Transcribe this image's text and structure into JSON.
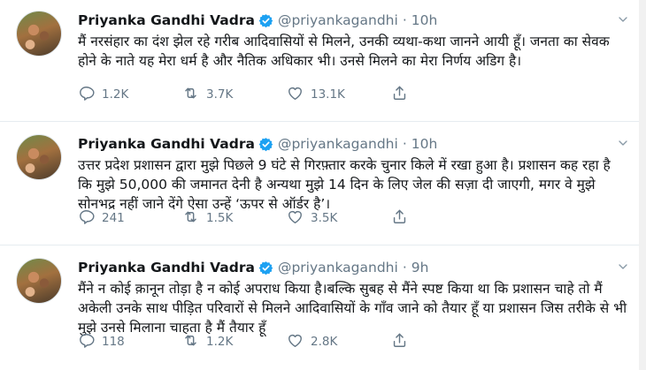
{
  "tweets": [
    {
      "name": "Priyanka Gandhi Vadra",
      "handle": "@priyankagandhi",
      "separator": "·",
      "time": "10h",
      "text": "मैं नरसंहार का दंश झेल रहे गरीब आदिवासियों से मिलने, उनकी व्यथा-कथा जानने आयी हूँ। जनता का सेवक होने के नाते यह मेरा धर्म है और नैतिक अधिकार भी। उनसे मिलने का मेरा निर्णय अडिग है।",
      "replies": "1.2K",
      "retweets": "3.7K",
      "likes": "13.1K"
    },
    {
      "name": "Priyanka Gandhi Vadra",
      "handle": "@priyankagandhi",
      "separator": "·",
      "time": "10h",
      "text": "उत्तर प्रदेश प्रशासन द्वारा मुझे पिछले 9 घंटे से गिरफ़्तार करके चुनार किले में रखा हुआ है। प्रशासन कह रहा है कि मुझे 50,000 की जमानत देनी है अन्यथा मुझे 14 दिन के लिए जेल की सज़ा दी जाएगी, मगर वे मुझे सोनभद्र नहीं जाने देंगे ऐसा उन्हें ‘ऊपर से ऑर्डर है’।",
      "replies": "241",
      "retweets": "1.5K",
      "likes": "3.5K"
    },
    {
      "name": "Priyanka Gandhi Vadra",
      "handle": "@priyankagandhi",
      "separator": "·",
      "time": "9h",
      "text": "मैंने न कोई क़ानून तोड़ा है न कोई अपराध किया है।बल्कि सुबह से मैंने स्पष्ट किया था कि प्रशासन चाहे तो मैं अकेली उनके साथ पीड़ित परिवारों से मिलने  आदिवासियों के गाँव जाने को तैयार हूँ या प्रशासन जिस तरीके से भी मुझे उनसे मिलाना चाहता है मैं तैयार हूँ",
      "replies": "118",
      "retweets": "1.2K",
      "likes": "2.8K"
    }
  ],
  "colors": {
    "verified": "#1da1f2",
    "muted": "#657786",
    "text": "#14171a",
    "border": "#e6ecf0"
  },
  "icons": [
    "verified-badge-icon",
    "reply-icon",
    "retweet-icon",
    "like-icon",
    "share-icon",
    "chevron-down-icon"
  ]
}
